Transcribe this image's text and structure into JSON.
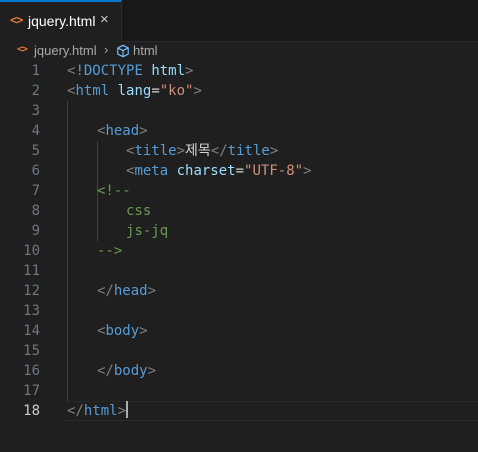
{
  "tab": {
    "icon": "html-file-icon",
    "label": "jquery.html",
    "close": "×"
  },
  "breadcrumb": {
    "file": "jquery.html",
    "separator": "›",
    "symbol": "html"
  },
  "lines": {
    "n1": "1",
    "n2": "2",
    "n3": "3",
    "n4": "4",
    "n5": "5",
    "n6": "6",
    "n7": "7",
    "n8": "8",
    "n9": "9",
    "n10": "10",
    "n11": "11",
    "n12": "12",
    "n13": "13",
    "n14": "14",
    "n15": "15",
    "n16": "16",
    "n17": "17",
    "n18": "18"
  },
  "code": {
    "l1_doctype": "!DOCTYPE",
    "l1_html": "html",
    "l2_tag": "html",
    "l2_attr": "lang",
    "l2_val": "\"ko\"",
    "l4_tag": "head",
    "l5_open": "title",
    "l5_text": "제목",
    "l5_close": "title",
    "l6_tag": "meta",
    "l6_attr": "charset",
    "l6_val": "\"UTF-8\"",
    "l7_comment": "<!--",
    "l8_comment": "css",
    "l9_comment": "js-jq",
    "l10_comment": "-->",
    "l12_tag": "head",
    "l14_tag": "body",
    "l16_tag": "body",
    "l18_tag": "html"
  },
  "active_line": 18,
  "colors": {
    "accent": "#0078d4",
    "tag": "#569cd6",
    "attribute": "#9cdcfe",
    "string": "#ce9178",
    "comment": "#6a9955"
  }
}
